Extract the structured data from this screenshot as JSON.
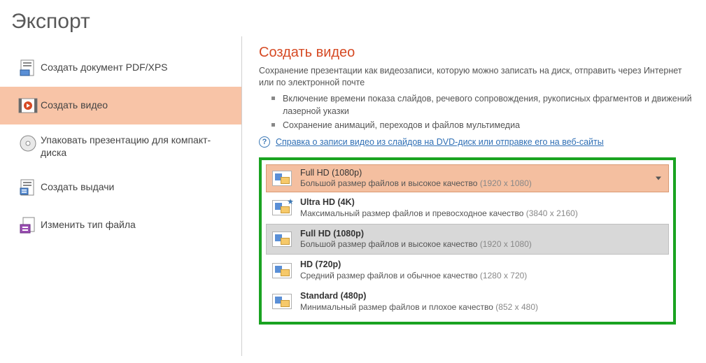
{
  "page_title": "Экспорт",
  "sidebar": {
    "items": [
      {
        "label": "Создать документ PDF/XPS"
      },
      {
        "label": "Создать видео"
      },
      {
        "label": "Упаковать презентацию для компакт-диска"
      },
      {
        "label": "Создать выдачи"
      },
      {
        "label": "Изменить тип файла"
      }
    ],
    "active_index": 1
  },
  "content": {
    "title": "Создать видео",
    "description": "Сохранение презентации как видеозаписи, которую можно записать на диск, отправить через Интернет или по электронной почте",
    "bullets": [
      "Включение времени показа слайдов, речевого сопровождения, рукописных фрагментов и движений лазерной указки",
      "Сохранение анимаций, переходов и файлов мультимедиа"
    ],
    "help_link": "Справка о записи видео из слайдов на DVD-диск или отправке его на веб-сайты",
    "help_symbol": "?"
  },
  "quality": {
    "selected_header": {
      "title": "Full HD (1080p)",
      "subtitle": "Большой размер файлов и высокое качество",
      "resolution": "(1920 x 1080)"
    },
    "options": [
      {
        "title": "Ultra HD (4K)",
        "subtitle": "Максимальный размер файлов и превосходное качество",
        "resolution": "(3840 x 2160)",
        "star": true
      },
      {
        "title": "Full HD (1080p)",
        "subtitle": "Большой размер файлов и высокое качество",
        "resolution": "(1920 x 1080)",
        "selected": true
      },
      {
        "title": "HD (720p)",
        "subtitle": "Средний размер файлов и обычное качество",
        "resolution": "(1280 x 720)"
      },
      {
        "title": "Standard (480p)",
        "subtitle": "Минимальный размер файлов и плохое качество",
        "resolution": "(852 x 480)"
      }
    ]
  }
}
